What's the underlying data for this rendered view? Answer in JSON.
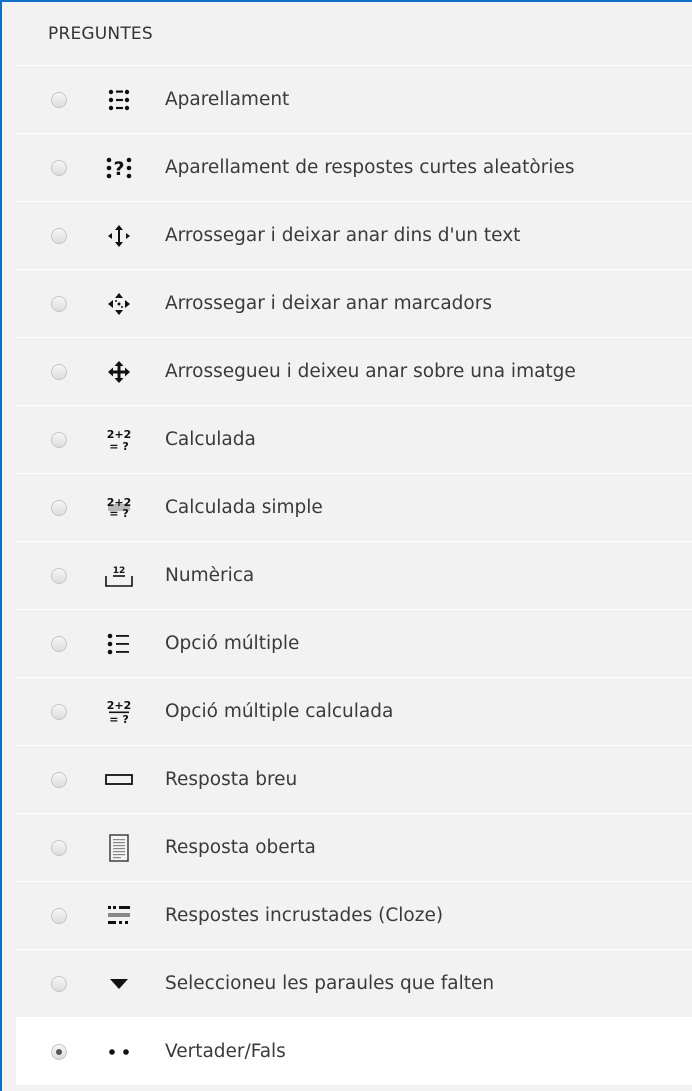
{
  "header": {
    "title": "PREGUNTES"
  },
  "items": [
    {
      "label": "Aparellament",
      "icon": "matching-icon"
    },
    {
      "label": "Aparellament de respostes curtes aleatòries",
      "icon": "random-short-answer-matching-icon"
    },
    {
      "label": "Arrossegar i deixar anar dins d'un text",
      "icon": "drag-drop-text-icon"
    },
    {
      "label": "Arrossegar i deixar anar marcadors",
      "icon": "drag-drop-markers-icon"
    },
    {
      "label": "Arrossegueu i deixeu anar sobre una imatge",
      "icon": "drag-drop-image-icon"
    },
    {
      "label": "Calculada",
      "icon": "calculated-icon"
    },
    {
      "label": "Calculada simple",
      "icon": "calculated-simple-icon"
    },
    {
      "label": "Numèrica",
      "icon": "numerical-icon"
    },
    {
      "label": "Opció múltiple",
      "icon": "multiple-choice-icon"
    },
    {
      "label": "Opció múltiple calculada",
      "icon": "calculated-multichoice-icon"
    },
    {
      "label": "Resposta breu",
      "icon": "short-answer-icon"
    },
    {
      "label": "Resposta oberta",
      "icon": "essay-icon"
    },
    {
      "label": "Respostes incrustades (Cloze)",
      "icon": "cloze-icon"
    },
    {
      "label": "Seleccioneu les paraules que falten",
      "icon": "select-missing-words-icon"
    },
    {
      "label": "Vertader/Fals",
      "icon": "true-false-icon",
      "selected": true
    }
  ],
  "icon_text": {
    "random_q": "?",
    "calc_top": "2+2",
    "calc_bottom": "= ?",
    "num_value": "12"
  }
}
